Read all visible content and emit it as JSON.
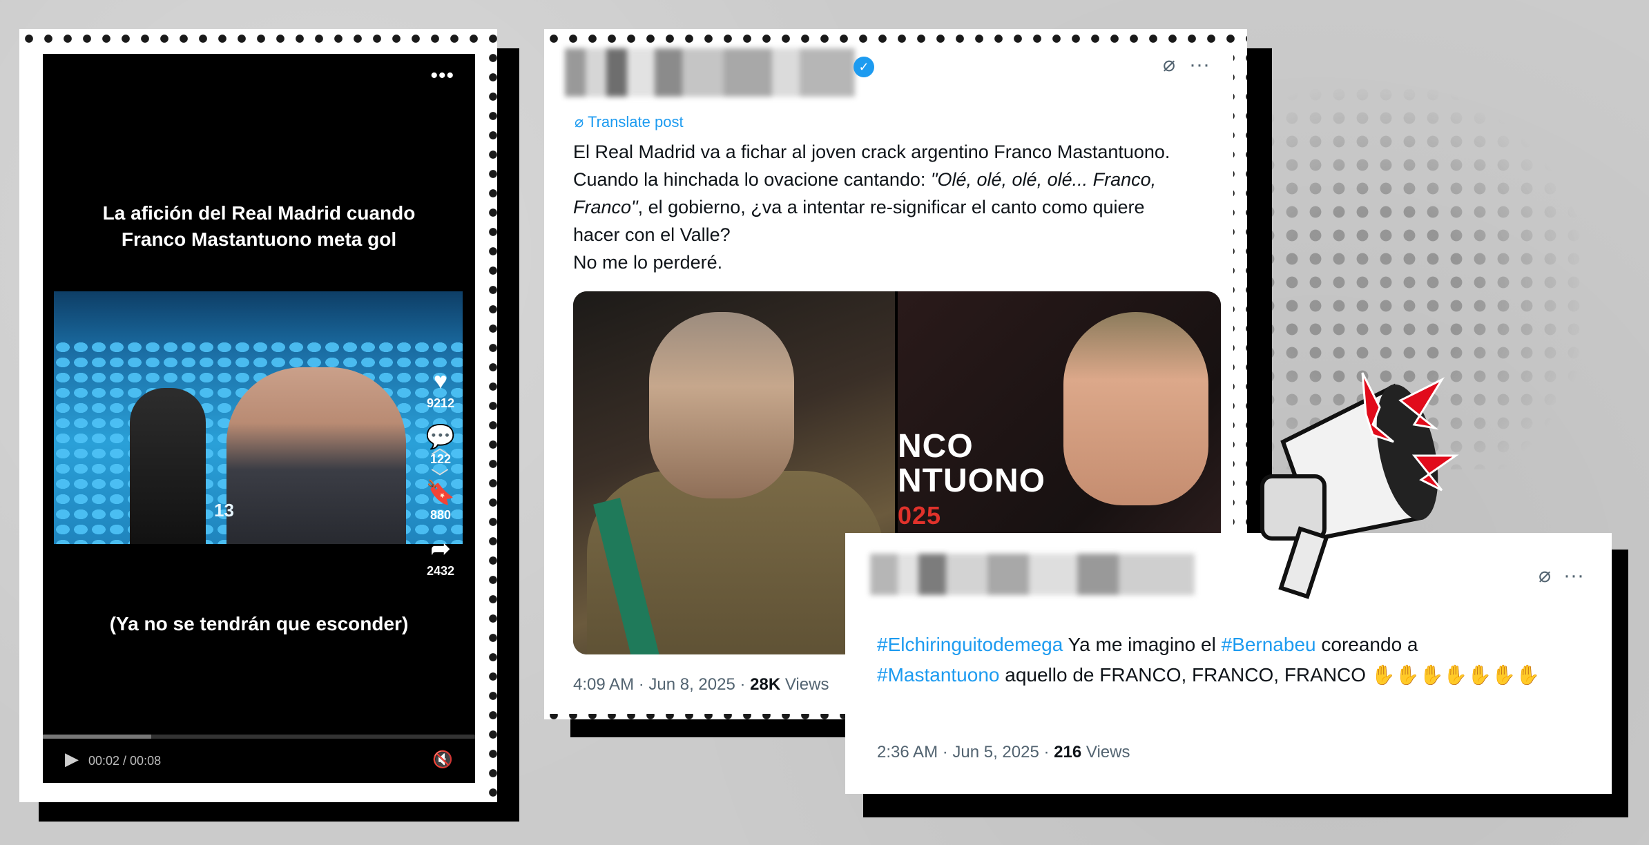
{
  "tiktok": {
    "caption": "La afición del Real Madrid cuando Franco Mastantuono meta gol",
    "subtitle": "(Ya no se tendrán que esconder)",
    "clip_number": "13",
    "likes": "9212",
    "comments": "122",
    "saves": "880",
    "shares": "2432",
    "time": "00:02 / 00:08",
    "progress_fraction": 0.25
  },
  "tweet1": {
    "translate_label": "Translate post",
    "text_line1": "El Real Madrid va a fichar al joven crack argentino Franco Mastantuono. Cuando la hinchada lo ovacione cantando: ",
    "quote": "\"Olé, olé, olé, olé... Franco, Franco\"",
    "text_line2": ", el gobierno, ¿va a intentar re-significar el canto como quiere hacer con el Valle?",
    "text_line3": "No me lo perderé.",
    "media_text1": "NCO",
    "media_text2": "NTUONO",
    "media_text3": "025",
    "meta": "4:09 AM · Jun 8, 2025 · ",
    "views_count": "28K",
    "views_label": " Views"
  },
  "tweet2": {
    "tag1": "#Elchiringuitodemega",
    "text1": " Ya me imagino el ",
    "tag2": "#Bernabeu",
    "text2": " coreando a ",
    "tag3": "#Mastantuono",
    "text3": " aquello de FRANCO, FRANCO, FRANCO ",
    "hands": "✋✋✋✋✋✋✋",
    "meta": "2:36 AM · Jun 5, 2025 · ",
    "views_count": "216",
    "views_label": " Views"
  }
}
